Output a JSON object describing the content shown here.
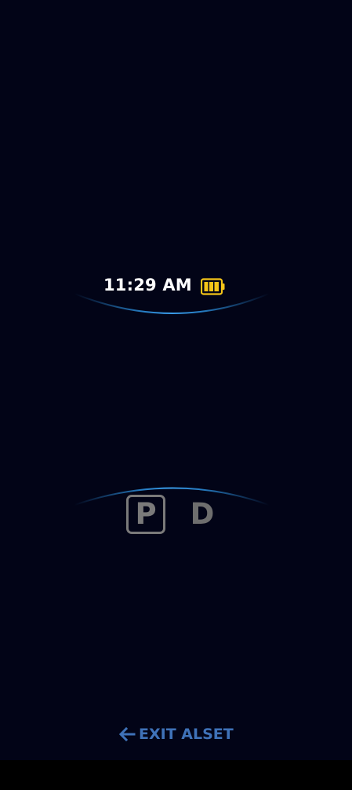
{
  "status": {
    "time": "11:29 AM",
    "battery_icon": "battery-full-icon",
    "battery_color": "#f5c518"
  },
  "shifter": {
    "gears": [
      "P",
      "D"
    ],
    "selected": "P"
  },
  "footer": {
    "exit_label": "EXIT ALSET",
    "exit_icon": "arrow-left-icon",
    "accent_color": "#3f72b8"
  },
  "colors": {
    "background": "#020417",
    "arc": "#2a8ad6",
    "inactive_gear": "#7a7a7a"
  }
}
